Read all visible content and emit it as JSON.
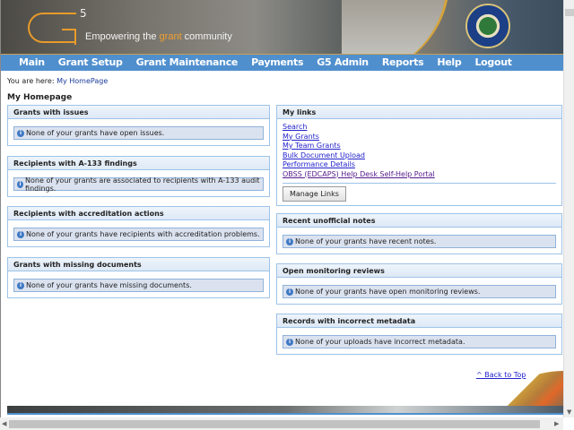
{
  "header": {
    "logo_superscript": "5",
    "tagline_pre": "Empowering the ",
    "tagline_hl": "grant",
    "tagline_post": " community"
  },
  "nav": [
    "Main",
    "Grant Setup",
    "Grant Maintenance",
    "Payments",
    "G5 Admin",
    "Reports",
    "Help",
    "Logout"
  ],
  "breadcrumb": {
    "label": "You are here: ",
    "current": "My HomePage"
  },
  "page_title": "My Homepage",
  "left_panels": [
    {
      "title": "Grants with issues",
      "message": "None of your grants have open issues."
    },
    {
      "title": "Recipients with A-133 findings",
      "message": "None of your grants are associated to recipients with A-133 audit findings."
    },
    {
      "title": "Recipients with accreditation actions",
      "message": "None of your grants have recipients with accreditation problems."
    },
    {
      "title": "Grants with missing documents",
      "message": "None of your grants have missing documents."
    }
  ],
  "my_links": {
    "title": "My links",
    "links": [
      "Search",
      "My Grants",
      "My Team Grants",
      "Bulk Document Upload",
      "Performance Details",
      "OBSS (EDCAPS) Help Desk Self-Help Portal"
    ],
    "manage_label": "Manage Links"
  },
  "right_panels": [
    {
      "title": "Recent unofficial notes",
      "message": "None of your grants have recent notes."
    },
    {
      "title": "Open monitoring reviews",
      "message": "None of your grants have open monitoring reviews."
    },
    {
      "title": "Records with incorrect metadata",
      "message": "None of your uploads have incorrect metadata."
    }
  ],
  "back_to_top": "^ Back to Top",
  "info_icon": "i",
  "colors": {
    "nav": "#4f8fce",
    "accent": "#e89b2a",
    "panel_border": "#9ec3e8"
  }
}
